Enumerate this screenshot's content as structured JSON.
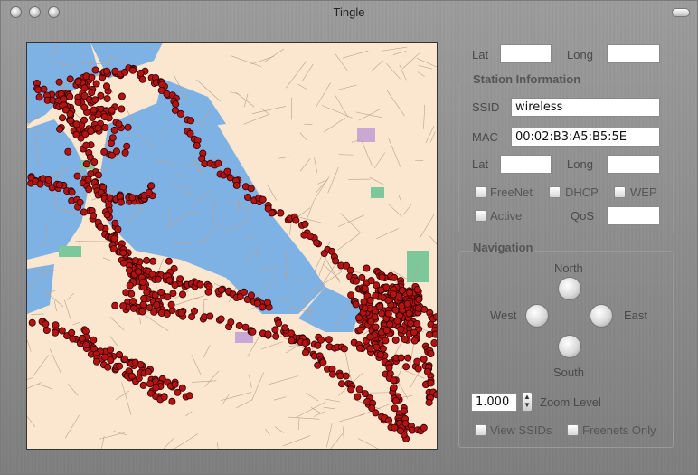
{
  "window": {
    "title": "Tingle"
  },
  "top": {
    "lat_label": "Lat",
    "long_label": "Long",
    "lat_value": "",
    "long_value": ""
  },
  "station": {
    "title": "Station Information",
    "ssid_label": "SSID",
    "ssid_value": "wireless",
    "mac_label": "MAC",
    "mac_value": "00:02:B3:A5:B5:5E",
    "lat_label": "Lat",
    "long_label": "Long",
    "lat_value": "",
    "long_value": "",
    "freenet_label": "FreeNet",
    "dhcp_label": "DHCP",
    "wep_label": "WEP",
    "active_label": "Active",
    "qos_label": "QoS",
    "qos_value": ""
  },
  "navigation": {
    "title": "Navigation",
    "north": "North",
    "south": "South",
    "east": "East",
    "west": "West",
    "zoom_value": "1.000",
    "zoom_label": "Zoom Level",
    "view_ssids_label": "View SSIDs",
    "freenets_only_label": "Freenets Only"
  },
  "colors": {
    "water": "#7fb2e4",
    "land": "#fbe7cf",
    "park": "#7cc89a",
    "marker": "#b51212"
  }
}
